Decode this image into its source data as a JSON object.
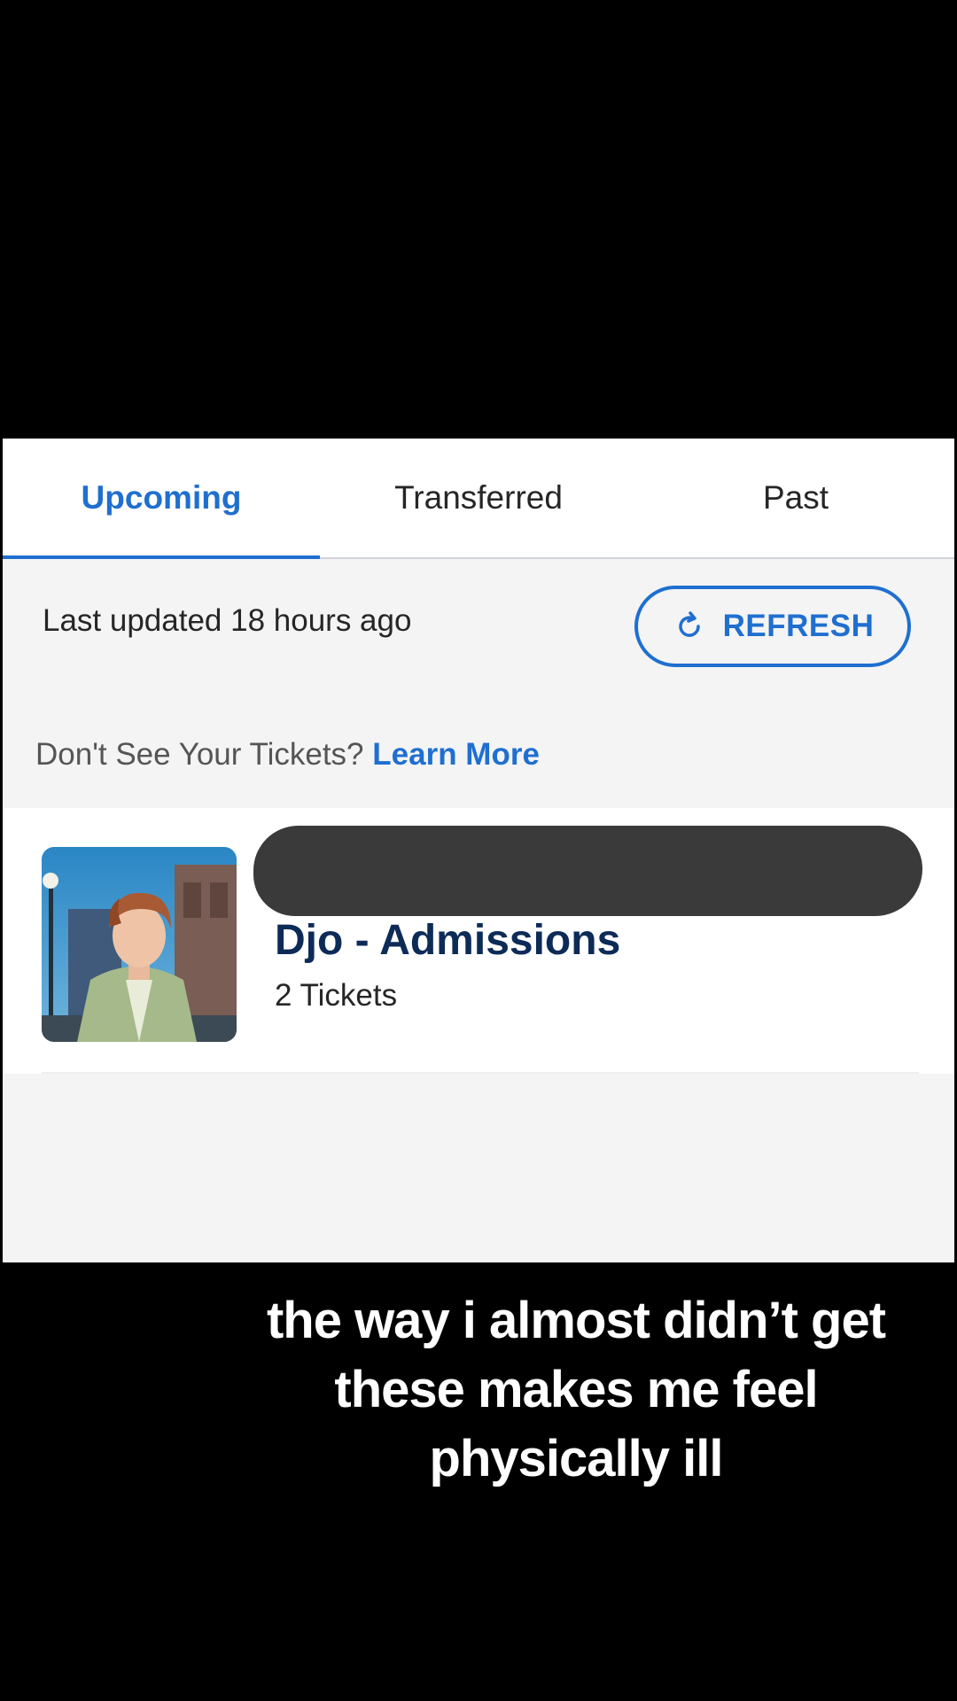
{
  "tabs": [
    {
      "label": "Upcoming",
      "active": true
    },
    {
      "label": "Transferred",
      "active": false
    },
    {
      "label": "Past",
      "active": false
    }
  ],
  "status": {
    "last_updated": "Last updated 18 hours ago",
    "refresh_label": "REFRESH",
    "refresh_icon": "refresh-icon"
  },
  "help": {
    "question": "Don't See Your Tickets?",
    "link": "Learn More"
  },
  "event": {
    "name": "Djo - Admissions",
    "tickets": "2 Tickets",
    "image_icon": "event-photo"
  },
  "caption": {
    "lines": [
      "the way i almost didn’t get",
      "these makes me feel",
      "physically ill"
    ]
  },
  "colors": {
    "accent": "#1f6fd0",
    "event_title": "#0d2b57",
    "background": "#f4f4f5"
  }
}
